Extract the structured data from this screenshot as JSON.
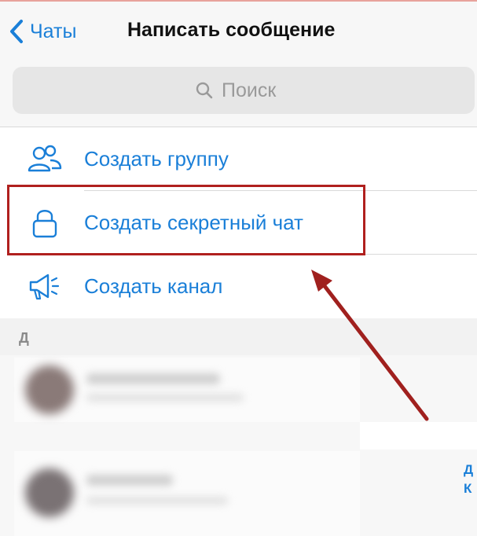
{
  "navbar": {
    "back_label": "Чаты",
    "title": "Написать сообщение"
  },
  "search": {
    "placeholder": "Поиск"
  },
  "menu": {
    "items": [
      {
        "label": "Создать группу",
        "icon": "group-icon"
      },
      {
        "label": "Создать секретный чат",
        "icon": "lock-icon"
      },
      {
        "label": "Создать канал",
        "icon": "megaphone-icon"
      }
    ]
  },
  "contacts": {
    "section_letter": "Д",
    "edge_labels": [
      "Д",
      "К"
    ]
  },
  "colors": {
    "accent": "#1a7fd8",
    "highlight": "#b0201e",
    "arrow": "#a0201e"
  }
}
